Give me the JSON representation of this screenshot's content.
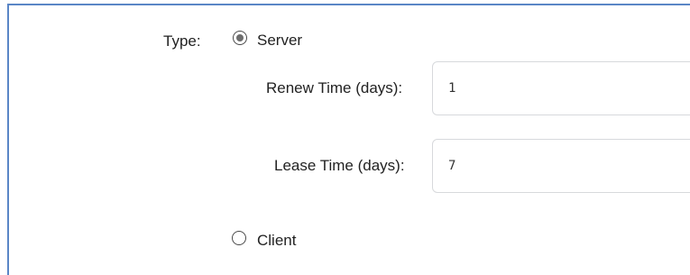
{
  "form": {
    "type_label": "Type:",
    "server_option": {
      "label": "Server",
      "checked": true
    },
    "renew_time": {
      "label": "Renew Time (days):",
      "value": "1"
    },
    "lease_time": {
      "label": "Lease Time (days):",
      "value": "7"
    },
    "client_option": {
      "label": "Client",
      "checked": false
    }
  },
  "colors": {
    "frame_border": "#5a86c6",
    "input_border": "#d7d9dc",
    "radio_border": "#4a4a4a",
    "radio_dot": "#6d6d6d"
  }
}
